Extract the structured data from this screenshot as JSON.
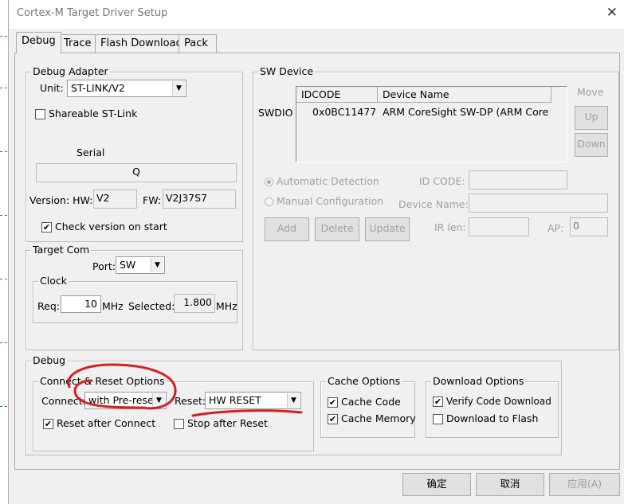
{
  "window": {
    "title": "Cortex-M Target Driver Setup",
    "close": "✕"
  },
  "tabs": [
    {
      "label": "Debug",
      "active": true
    },
    {
      "label": "Trace"
    },
    {
      "label": "Flash Download"
    },
    {
      "label": "Pack"
    }
  ],
  "debug_adapter": {
    "label": "Debug Adapter",
    "unit_label": "Unit:",
    "unit_value": "ST-LINK/V2",
    "shareable_label": "Shareable ST-Link",
    "shareable": false,
    "serial_label": "Serial",
    "serial_value": "Q",
    "version_label": "Version: HW:",
    "hw_value": "V2",
    "fw_label": "FW:",
    "fw_value": "V2J37S7",
    "check_version_label": "Check version on start",
    "check_version": true
  },
  "target_com": {
    "label": "Target Com",
    "port_label": "Port:",
    "port_value": "SW",
    "clock_label": "Clock",
    "req_label": "Req:",
    "req_value": "10",
    "req_unit": "MHz",
    "selected_label": "Selected:",
    "selected_value": "1.800",
    "selected_unit": "MHz"
  },
  "sw_device": {
    "label": "SW Device",
    "row_label": "SWDIO",
    "columns": [
      "IDCODE",
      "Device Name"
    ],
    "rows": [
      {
        "idcode": "0x0BC11477",
        "device_name": "ARM CoreSight SW-DP (ARM Core"
      }
    ],
    "move_label": "Move",
    "up": "Up",
    "down": "Down",
    "auto_detect": "Automatic Detection",
    "manual_config": "Manual Configuration",
    "id_code_label": "ID CODE:",
    "device_name_label": "Device Name:",
    "ir_len_label": "IR len:",
    "ap_label": "AP:",
    "ap_value": "0",
    "add": "Add",
    "delete": "Delete",
    "update": "Update"
  },
  "debug": {
    "label": "Debug",
    "connect_reset": {
      "label": "Connect & Reset Options",
      "connect_label": "Connect:",
      "connect_value": "with Pre-reset",
      "reset_label": "Reset:",
      "reset_value": "HW RESET",
      "reset_after_connect": "Reset after Connect",
      "reset_after_connect_checked": true,
      "stop_after_reset": "Stop after Reset",
      "stop_after_reset_checked": false
    },
    "cache": {
      "label": "Cache Options",
      "cache_code": "Cache Code",
      "cache_memory": "Cache Memory"
    },
    "download": {
      "label": "Download Options",
      "verify": "Verify Code Download",
      "to_flash": "Download to Flash"
    }
  },
  "footer": {
    "ok": "确定",
    "cancel": "取消",
    "apply": "应用(A)"
  },
  "annotation_color": "#d42020"
}
